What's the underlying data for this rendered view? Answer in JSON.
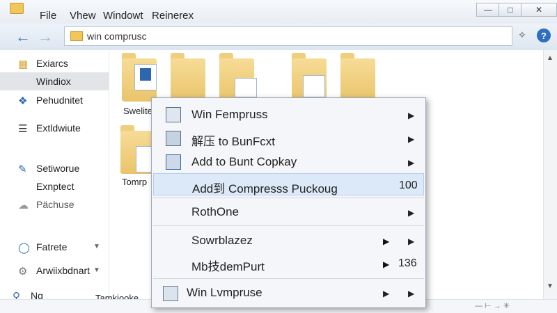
{
  "menubar": [
    "File",
    "Vhew",
    "Windowt",
    "Reinerex"
  ],
  "address": {
    "path": "win comprusc"
  },
  "sidebar": {
    "items": [
      {
        "label": "Exiarcs"
      },
      {
        "label": "Windiox"
      },
      {
        "label": "Pehudnitet"
      },
      {
        "label": "Extldwiute"
      },
      {
        "label": "Setiworue"
      },
      {
        "label": "Exnptect"
      },
      {
        "label": "Pächuse"
      },
      {
        "label": "Fatrete"
      },
      {
        "label": "Arwiixbdnart"
      },
      {
        "label": "Ng"
      }
    ]
  },
  "files": [
    {
      "name": "Swelite"
    },
    {
      "name": "Tomrp"
    },
    {
      "name": "Tamkiooke"
    }
  ],
  "context_menu": {
    "items": [
      {
        "label": "Win Fempruss"
      },
      {
        "label": "解压 to BunFcxt"
      },
      {
        "label": "Add to Bunt Copkay"
      },
      {
        "label": "Add到 Compresss Puckoug",
        "value": "100"
      },
      {
        "label": "RothOne"
      },
      {
        "label": "Sowrblazez"
      },
      {
        "label": "Mb技demPurt",
        "value": "136"
      },
      {
        "label": "Win Lvmpruse"
      }
    ]
  },
  "colors": {
    "accent": "#3a78c8",
    "highlight": "#dce9f8",
    "folder": "#f1c75a"
  }
}
